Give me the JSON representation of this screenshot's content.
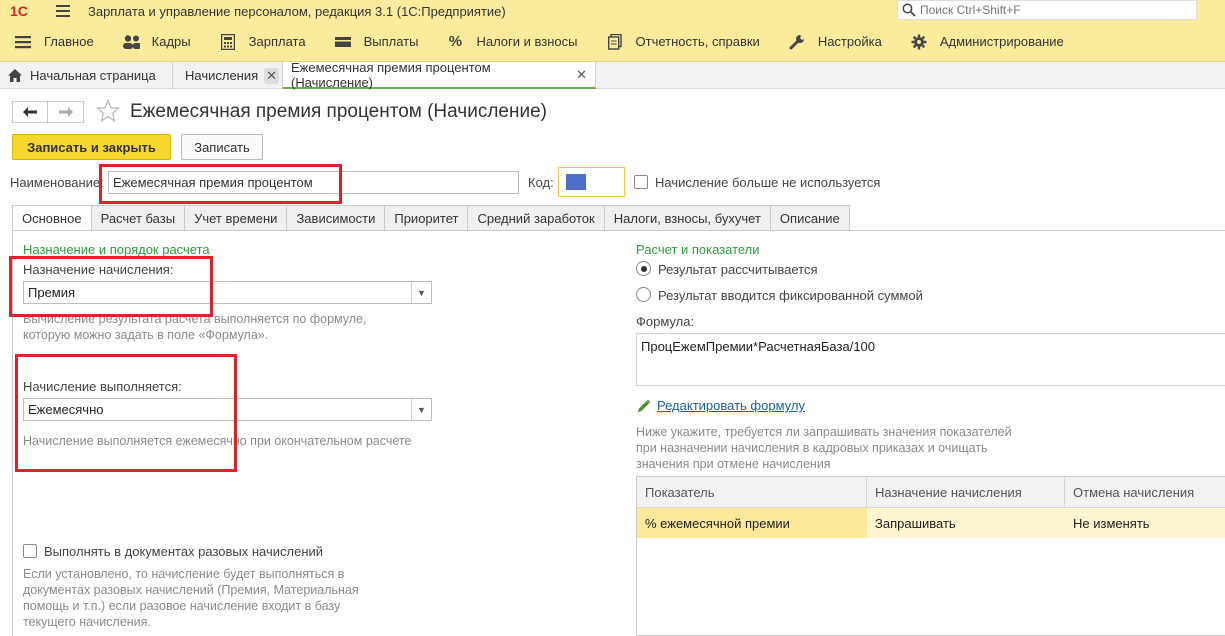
{
  "app": {
    "logo": "1С",
    "title": "Зарплата и управление персоналом, редакция 3.1  (1С:Предприятие)",
    "search_placeholder": "Поиск Ctrl+Shift+F"
  },
  "sections": [
    {
      "label": "Главное",
      "icon": "menu-icon"
    },
    {
      "label": "Кадры",
      "icon": "people-icon"
    },
    {
      "label": "Зарплата",
      "icon": "calculator-icon"
    },
    {
      "label": "Выплаты",
      "icon": "wallet-icon"
    },
    {
      "label": "Налоги и взносы",
      "icon": "percent-icon"
    },
    {
      "label": "Отчетность, справки",
      "icon": "reports-icon"
    },
    {
      "label": "Настройка",
      "icon": "wrench-icon"
    },
    {
      "label": "Администрирование",
      "icon": "gear-icon"
    }
  ],
  "window_tabs": [
    {
      "label": "Начальная страница"
    },
    {
      "label": "Начисления"
    },
    {
      "label": "Ежемесячная премия процентом (Начисление)"
    }
  ],
  "form": {
    "title": "Ежемесячная премия процентом (Начисление)",
    "save_close": "Записать и закрыть",
    "save": "Записать",
    "name_label": "Наименование:",
    "name_value": "Ежемесячная премия процентом",
    "code_label": "Код:",
    "not_used_label": "Начисление больше не используется"
  },
  "form_tabs": [
    "Основное",
    "Расчет базы",
    "Учет времени",
    "Зависимости",
    "Приоритет",
    "Средний заработок",
    "Налоги, взносы, бухучет",
    "Описание"
  ],
  "left": {
    "group_title": "Назначение и порядок расчета",
    "purpose_label": "Назначение начисления:",
    "purpose_value": "Премия",
    "purpose_hint_1": "Вычисление результата расчета выполняется по формуле,",
    "purpose_hint_2": "которую можно задать в поле «Формула».",
    "performed_label": "Начисление выполняется:",
    "performed_value": "Ежемесячно",
    "performed_hint": "Начисление выполняется ежемесячно при окончательном расчете",
    "one_time_label": "Выполнять в документах разовых начислений",
    "one_time_hint_1": "Если установлено, то начисление будет выполняться в",
    "one_time_hint_2": "документах разовых начислений (Премия, Материальная",
    "one_time_hint_3": "помощь и т.п.) если разовое начисление входит в базу",
    "one_time_hint_4": "текущего начисления."
  },
  "right": {
    "group_title": "Расчет и показатели",
    "radio_calculated": "Результат рассчитывается",
    "radio_fixed": "Результат вводится фиксированной суммой",
    "formula_label": "Формула:",
    "formula_value": "ПроцЕжемПремии*РасчетнаяБаза/100",
    "edit_formula": "Редактировать формулу",
    "hint_1": "Ниже укажите, требуется ли запрашивать значения показателей",
    "hint_2": "при назначении начисления в кадровых приказах и очищать",
    "hint_3": "значения при отмене начисления",
    "table": {
      "headers": [
        "Показатель",
        "Назначение начисления",
        "Отмена начисления"
      ],
      "rows": [
        [
          "% ежемесячной премии",
          "Запрашивать",
          "Не изменять"
        ]
      ]
    }
  },
  "colors": {
    "accent": "#fbeb9c",
    "primary_button": "#f7d630",
    "group_title": "#2d9b3d",
    "annotation": "#e0202a"
  }
}
